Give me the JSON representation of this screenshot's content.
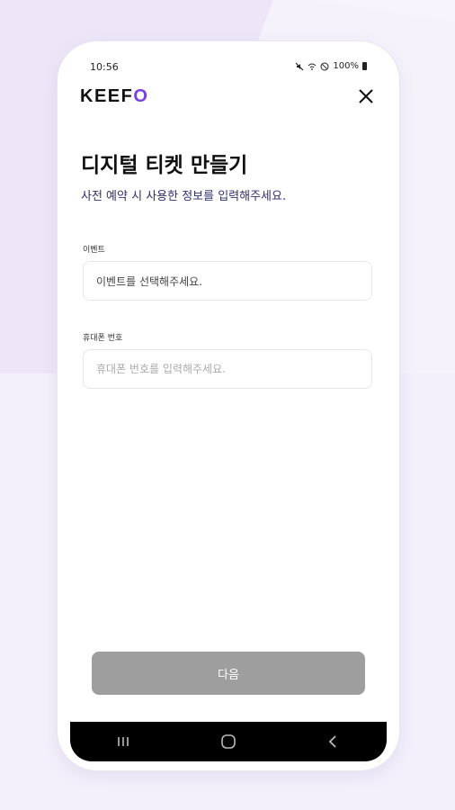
{
  "status_bar": {
    "time": "10:56",
    "battery": "100%",
    "icons": [
      "mute-icon",
      "wifi-off-icon",
      "do-not-disturb-icon",
      "battery-icon"
    ]
  },
  "app": {
    "logo_main": "KEEF",
    "logo_accent": "O",
    "close_icon": "close-icon"
  },
  "page": {
    "title": "디지털 티켓 만들기",
    "subtitle": "사전 예약 시 사용한 정보를 입력해주세요."
  },
  "form": {
    "event": {
      "label": "이벤트",
      "value": "이벤트를 선택해주세요."
    },
    "phone": {
      "label": "휴대폰 번호",
      "placeholder": "휴대폰 번호를 입력해주세요."
    }
  },
  "actions": {
    "next_label": "다음"
  },
  "nav": {
    "icons": [
      "recent-apps-icon",
      "home-icon",
      "back-icon"
    ]
  },
  "colors": {
    "accent": "#7a3fe4",
    "subtitle": "#2d2f6e",
    "button_disabled": "#9e9e9e",
    "background": "#f3effb"
  }
}
